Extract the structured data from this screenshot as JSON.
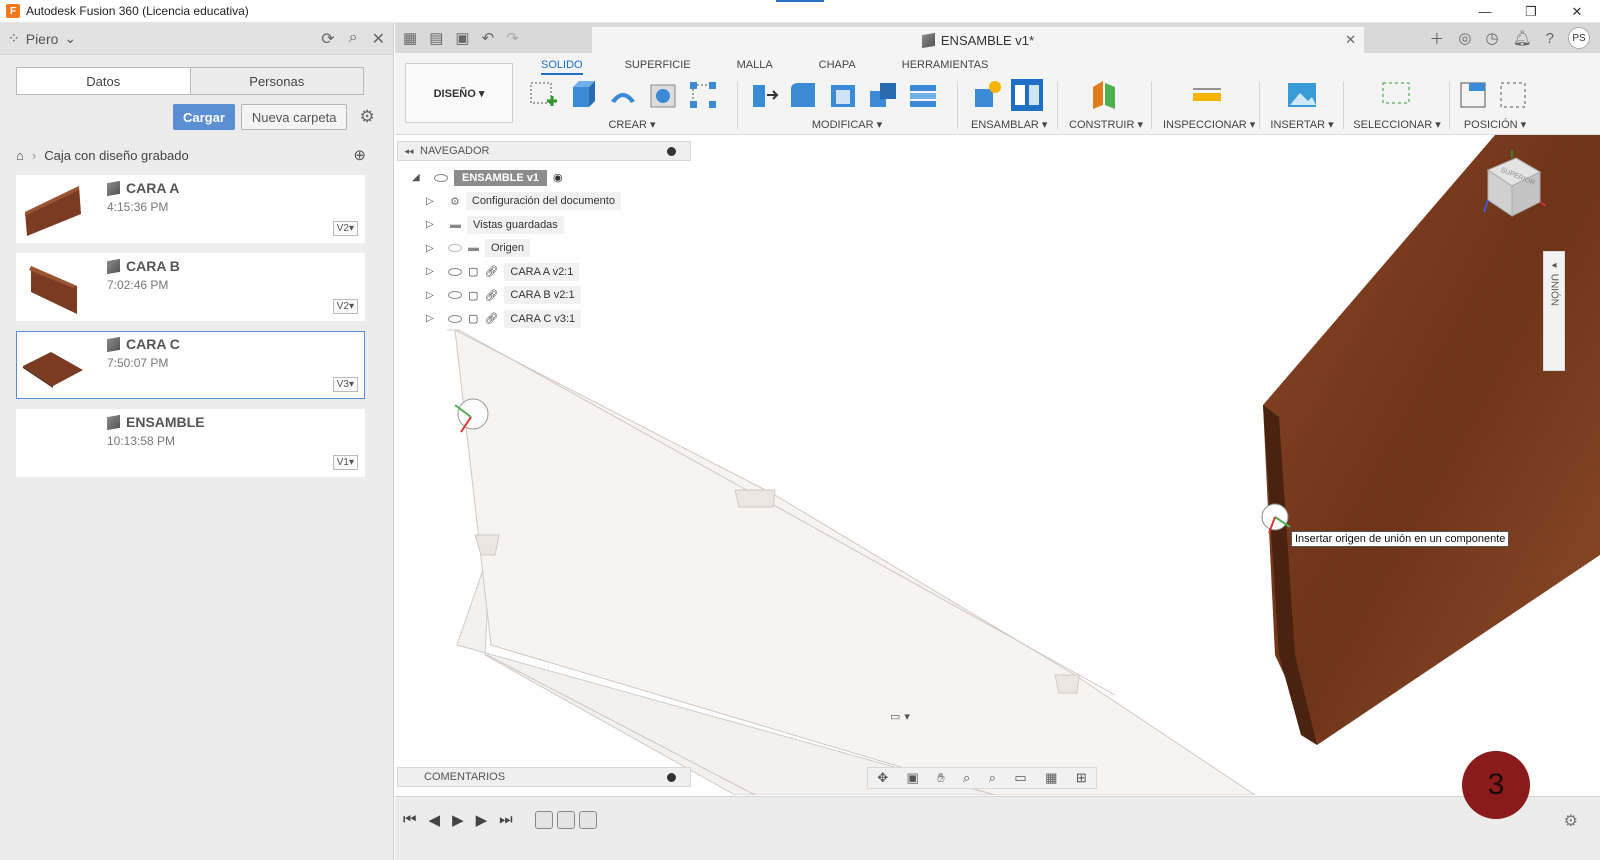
{
  "window": {
    "title": "Autodesk Fusion 360 (Licencia educativa)",
    "app_icon": "F",
    "controls": [
      "—",
      "❐",
      "✕"
    ]
  },
  "data_panel": {
    "user": "Piero",
    "tabs": [
      "Datos",
      "Personas"
    ],
    "upload_label": "Cargar",
    "new_folder_label": "Nueva carpeta",
    "breadcrumb": "Caja con diseño grabado",
    "files": [
      {
        "name": "CARA A",
        "time": "4:15:36 PM",
        "version": "V2▾"
      },
      {
        "name": "CARA B",
        "time": "7:02:46 PM",
        "version": "V2▾"
      },
      {
        "name": "CARA C",
        "time": "7:50:07 PM",
        "version": "V3▾"
      },
      {
        "name": "ENSAMBLE",
        "time": "10:13:58 PM",
        "version": "V1▾"
      }
    ]
  },
  "document": {
    "tab_title": "ENSAMBLE v1*",
    "avatar": "PS"
  },
  "toolbar": {
    "design_label": "DISEÑO ▾",
    "tabs": [
      "SOLIDO",
      "SUPERFICIE",
      "MALLA",
      "CHAPA",
      "HERRAMIENTAS"
    ],
    "groups": {
      "create": "CREAR ▾",
      "modify": "MODIFICAR ▾",
      "assemble": "ENSAMBLAR ▾",
      "construct": "CONSTRUIR ▾",
      "inspect": "INSPECCIONAR ▾",
      "insert": "INSERTAR ▾",
      "select": "SELECCIONAR ▾",
      "position": "POSICIÓN ▾"
    }
  },
  "navigator": {
    "title": "NAVEGADOR",
    "root": "ENSAMBLE v1",
    "items": [
      {
        "label": "Configuración del documento",
        "icon": "gear-icon"
      },
      {
        "label": "Vistas guardadas",
        "icon": "folder-icon"
      },
      {
        "label": "Origen",
        "icon": "folder-icon"
      },
      {
        "label": "CARA A v2:1",
        "icon": "link-icon"
      },
      {
        "label": "CARA B v2:1",
        "icon": "link-icon"
      },
      {
        "label": "CARA C v3:1",
        "icon": "link-icon"
      }
    ]
  },
  "comments_label": "COMENTARIOS",
  "tooltip": "Insertar origen de unión en un componente",
  "union_tab": "◂ UNIÓN",
  "viewcube_label": "SUPERIOR",
  "step_badge": "3",
  "colors": {
    "accent": "#1f6fc5",
    "wood": "#7a3b22",
    "badge": "#8b1a1a"
  }
}
